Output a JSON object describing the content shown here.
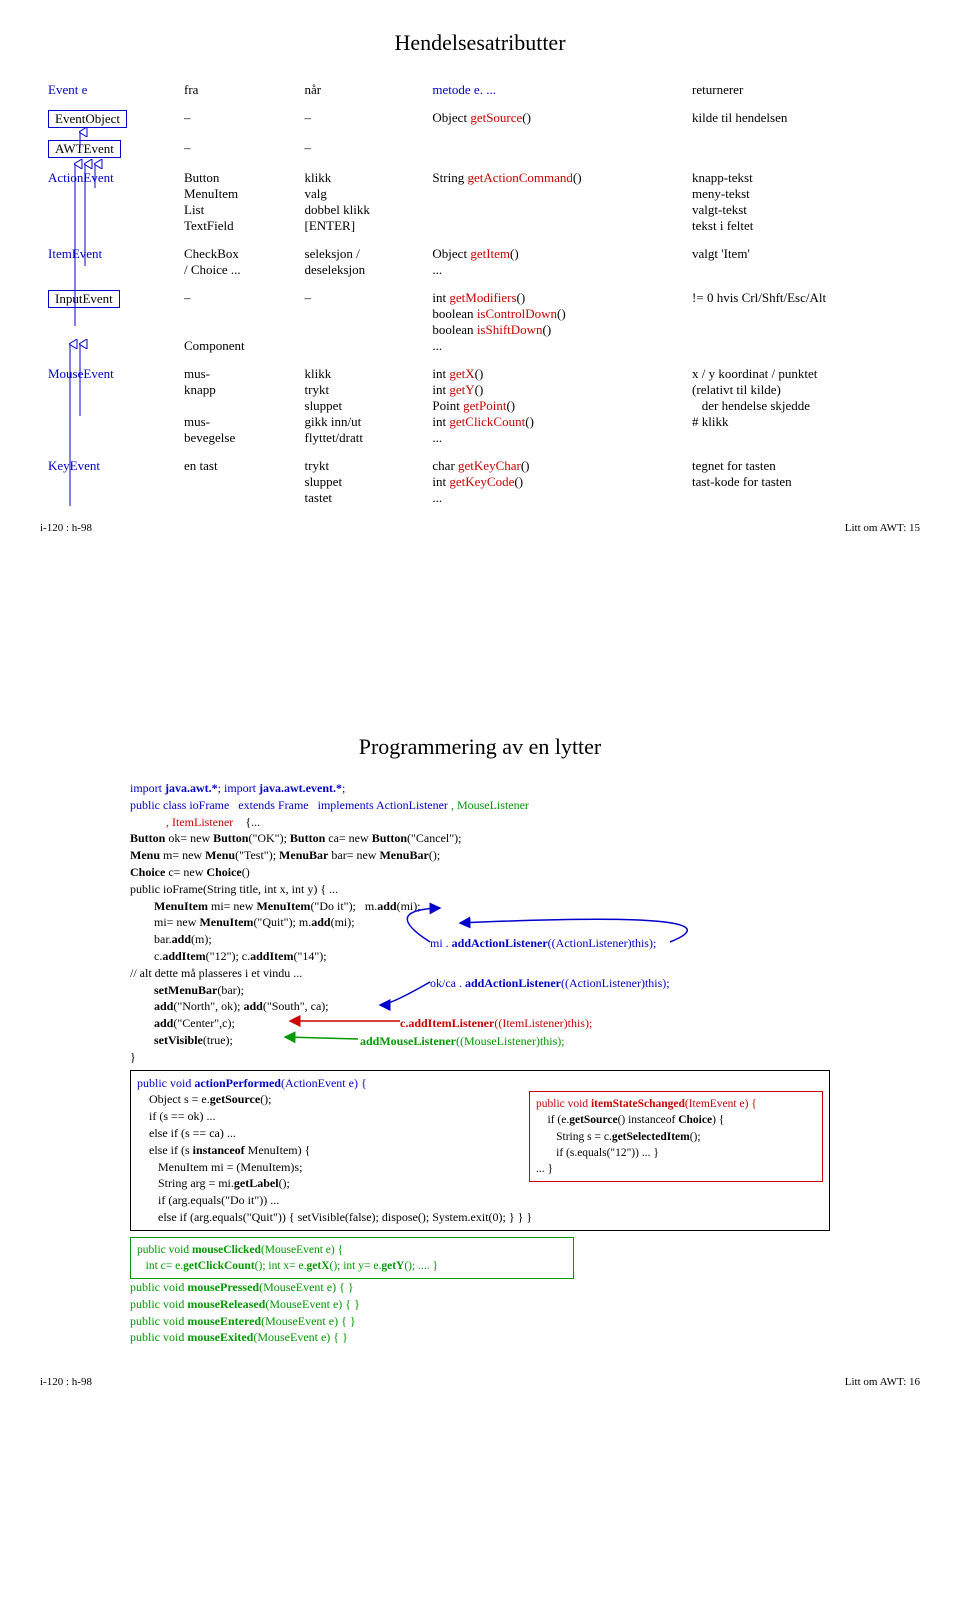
{
  "page1": {
    "title": "Hendelsesatributter",
    "headers": {
      "c1": "Event e",
      "c2": "fra",
      "c3": "når",
      "c4": "metode e. ...",
      "c5": "returnerer"
    },
    "rows": [
      {
        "c1": "EventObject",
        "c2": "–",
        "c3": "–",
        "c4": "Object getSource()",
        "c5": "kilde til hendelsen"
      },
      {
        "c1": "AWTEvent",
        "c2": "–",
        "c3": "–",
        "c4": "",
        "c5": ""
      },
      {
        "c1": "ActionEvent",
        "c2": "Button\nMenuItem\nList\nTextField",
        "c3": "klikk\nvalg\ndobbel klikk\n[ENTER]",
        "c4": "String getActionCommand()",
        "c5": "knapp-tekst\nmeny-tekst\nvalgt-tekst\ntekst i feltet"
      },
      {
        "c1": "ItemEvent",
        "c2": "CheckBox\n/ Choice ...",
        "c3": "seleksjon /\ndeseleksjon",
        "c4": "Object getItem()\n...",
        "c5": "valgt 'Item'"
      },
      {
        "c1": "InputEvent",
        "c2": "–\n\n\nComponent",
        "c3": "–",
        "c4": "int getModifiers()\nboolean isControlDown()\nboolean isShiftDown()\n...",
        "c5": "!= 0 hvis Crl/Shft/Esc/Alt"
      },
      {
        "c1": "MouseEvent",
        "c2": "mus-\nknapp\n\nmus-\nbevegelse",
        "c3": "klikk\ntrykt\nsluppet\ngikk inn/ut\nflyttet/dratt",
        "c4": "int getX()\nint getY()\nPoint getPoint()\nint getClickCount()\n...",
        "c5": "x / y koordinat / punktet\n(relativt til kilde)\n   der hendelse skjedde\n# klikk"
      },
      {
        "c1": "KeyEvent",
        "c2": "en tast",
        "c3": "trykt\nsluppet\ntastet",
        "c4": "char getKeyChar()\nint getKeyCode()\n...",
        "c5": "tegnet for tasten\ntast-kode for tasten"
      }
    ],
    "footer_left": "i-120 : h-98",
    "footer_right": "Litt om AWT:  15"
  },
  "page2": {
    "title": "Programmering av en lytter",
    "line_import": "import java.awt.*; import java.awt.event.*;",
    "cls_a": "public class ioFrame   extends Frame   implements ",
    "cls_b": "ActionListener",
    "cls_c": " , ",
    "cls_d": "MouseListener",
    "cls_e": "            , ",
    "cls_f": "ItemListener",
    "cls_g": "    {...",
    "g1": "Button ok= new Button(\"OK\"); Button ca= new Button(\"Cancel\");",
    "g2": "Menu m= new Menu(\"Test\"); MenuBar bar= new MenuBar();",
    "g3": "Choice c= new Choice()",
    "ctor_h": "public ioFrame(String title, int x, int y) { ...",
    "ctor_1a": "        MenuItem mi= new MenuItem(\"Do it\");   m.add(mi);",
    "ctor_2a": "        mi= new MenuItem(\"Quit\"); m.add(mi);",
    "ctor_3a": "        bar.add(m);",
    "ctor_4a": "        c.addItem(\"12\"); c.addItem(\"14\");",
    "ctor_5": "// alt dette må plasseres i et vindu ...",
    "ctor_6": "        setMenuBar(bar);",
    "ctor_7": "        add(\"North\", ok); add(\"South\", ca);",
    "ctor_8": "        add(\"Center\",c);",
    "ctor_9": "        setVisible(true);",
    "ctor_close": "}",
    "annot_mi": "mi . addActionListener((ActionListener)this);",
    "annot_okca": "ok/ca . addActionListener((ActionListener)this);",
    "annot_c": "c.addItemListener((ItemListener)this);",
    "annot_ml": "addMouseListener((MouseListener)this);",
    "ap_h": "public void actionPerformed(ActionEvent e) {",
    "ap_1": "    Object s = e.getSource();",
    "ap_2": "    if (s == ok) ...",
    "ap_3": "    else if (s == ca) ...",
    "ap_4": "    else if (s instanceof MenuItem) {",
    "ap_5": "       MenuItem mi = (MenuItem)s;",
    "ap_6": "       String arg = mi.getLabel();",
    "ap_7": "       if (arg.equals(\"Do it\")) ...",
    "ap_8": "       else if (arg.equals(\"Quit\")) { setVisible(false); dispose(); System.exit(0); } } }",
    "isc_h": "public void itemStateSchanged(ItemEvent e) {",
    "isc_1": "    if (e.getSource() instanceof Choice) {",
    "isc_2": "       String s = c.getSelectedItem();",
    "isc_3": "       if (s.equals(\"12\")) ... }",
    "isc_4": "... }",
    "mc_h": "public void mouseClicked(MouseEvent e) {",
    "mc_1": "   int c= e.getClickCount(); int x= e.getX(); int y= e.getY(); .... }",
    "mp": "public void mousePressed(MouseEvent e) { }",
    "mr": "public void mouseReleased(MouseEvent e) { }",
    "men": "public void mouseEntered(MouseEvent e) { }",
    "mex": "public void mouseExited(MouseEvent e) { }",
    "footer_left": "i-120 : h-98",
    "footer_right": "Litt om AWT:  16"
  }
}
